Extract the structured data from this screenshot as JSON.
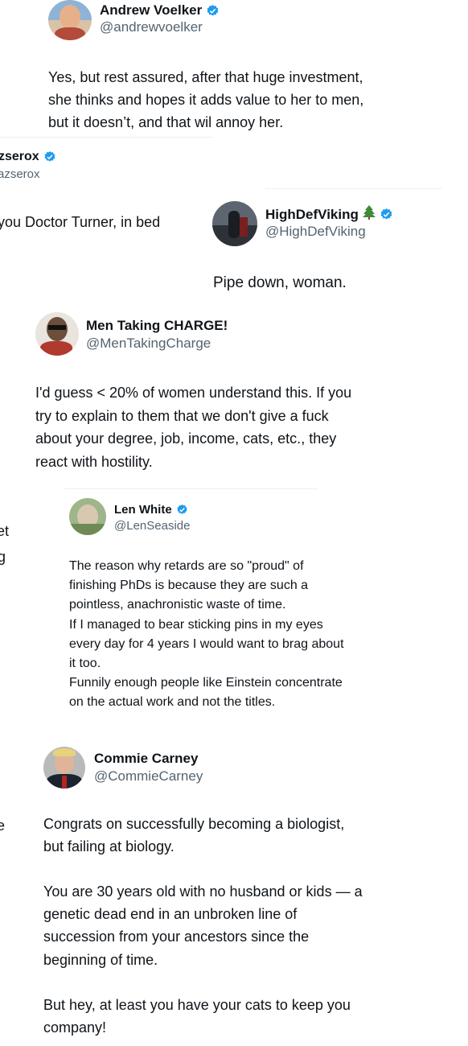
{
  "tweets": [
    {
      "name": "Andrew Voelker",
      "handle": "@andrewvoelker",
      "verified": true,
      "text": "Yes, but rest assured, after that huge investment,\nshe thinks and hopes it adds value to her to men,\nbut it doesn’t, and that wil annoy her."
    },
    {
      "name": "zserox",
      "handle": "azserox",
      "verified": true,
      "text": "you Doctor Turner, in bed"
    },
    {
      "name": "HighDefViking",
      "name_emoji": "evergreen-tree-emoji",
      "handle": "@HighDefViking",
      "verified": true,
      "text": "Pipe down, woman."
    },
    {
      "name": "Men Taking CHARGE!",
      "handle": "@MenTakingCharge",
      "verified": false,
      "text": "I'd guess < 20% of women understand this. If you\ntry to explain to them that we don't give a fuck\nabout your degree, job, income, cats, etc., they\nreact with hostility."
    },
    {
      "name": "Len White",
      "handle": "@LenSeaside",
      "verified": true,
      "text": "The reason why retards are so \"proud\" of\nfinishing PhDs is because they are such a\npointless, anachronistic waste of time.\nIf I managed to bear sticking pins in my eyes\nevery day for 4 years I would want to brag about\nit too.\nFunnily enough people like Einstein concentrate\non the actual work and not the titles."
    },
    {
      "name": "Commie Carney",
      "handle": "@CommieCarney",
      "verified": false,
      "text": "Congrats on successfully becoming a biologist,\nbut failing at biology.\n\nYou are 30 years old with no husband or kids — a\ngenetic dead end in an unbroken line of\nsuccession from your ancestors since the\nbeginning of time.\n\nBut hey, at least you have your cats to keep you\ncompany!"
    }
  ],
  "fragments": {
    "left_et": "et",
    "left_g": "g",
    "left_e": "e"
  },
  "colors": {
    "verified_blue": "#1d9bf0",
    "text": "#0f1419",
    "handle": "#536471"
  }
}
